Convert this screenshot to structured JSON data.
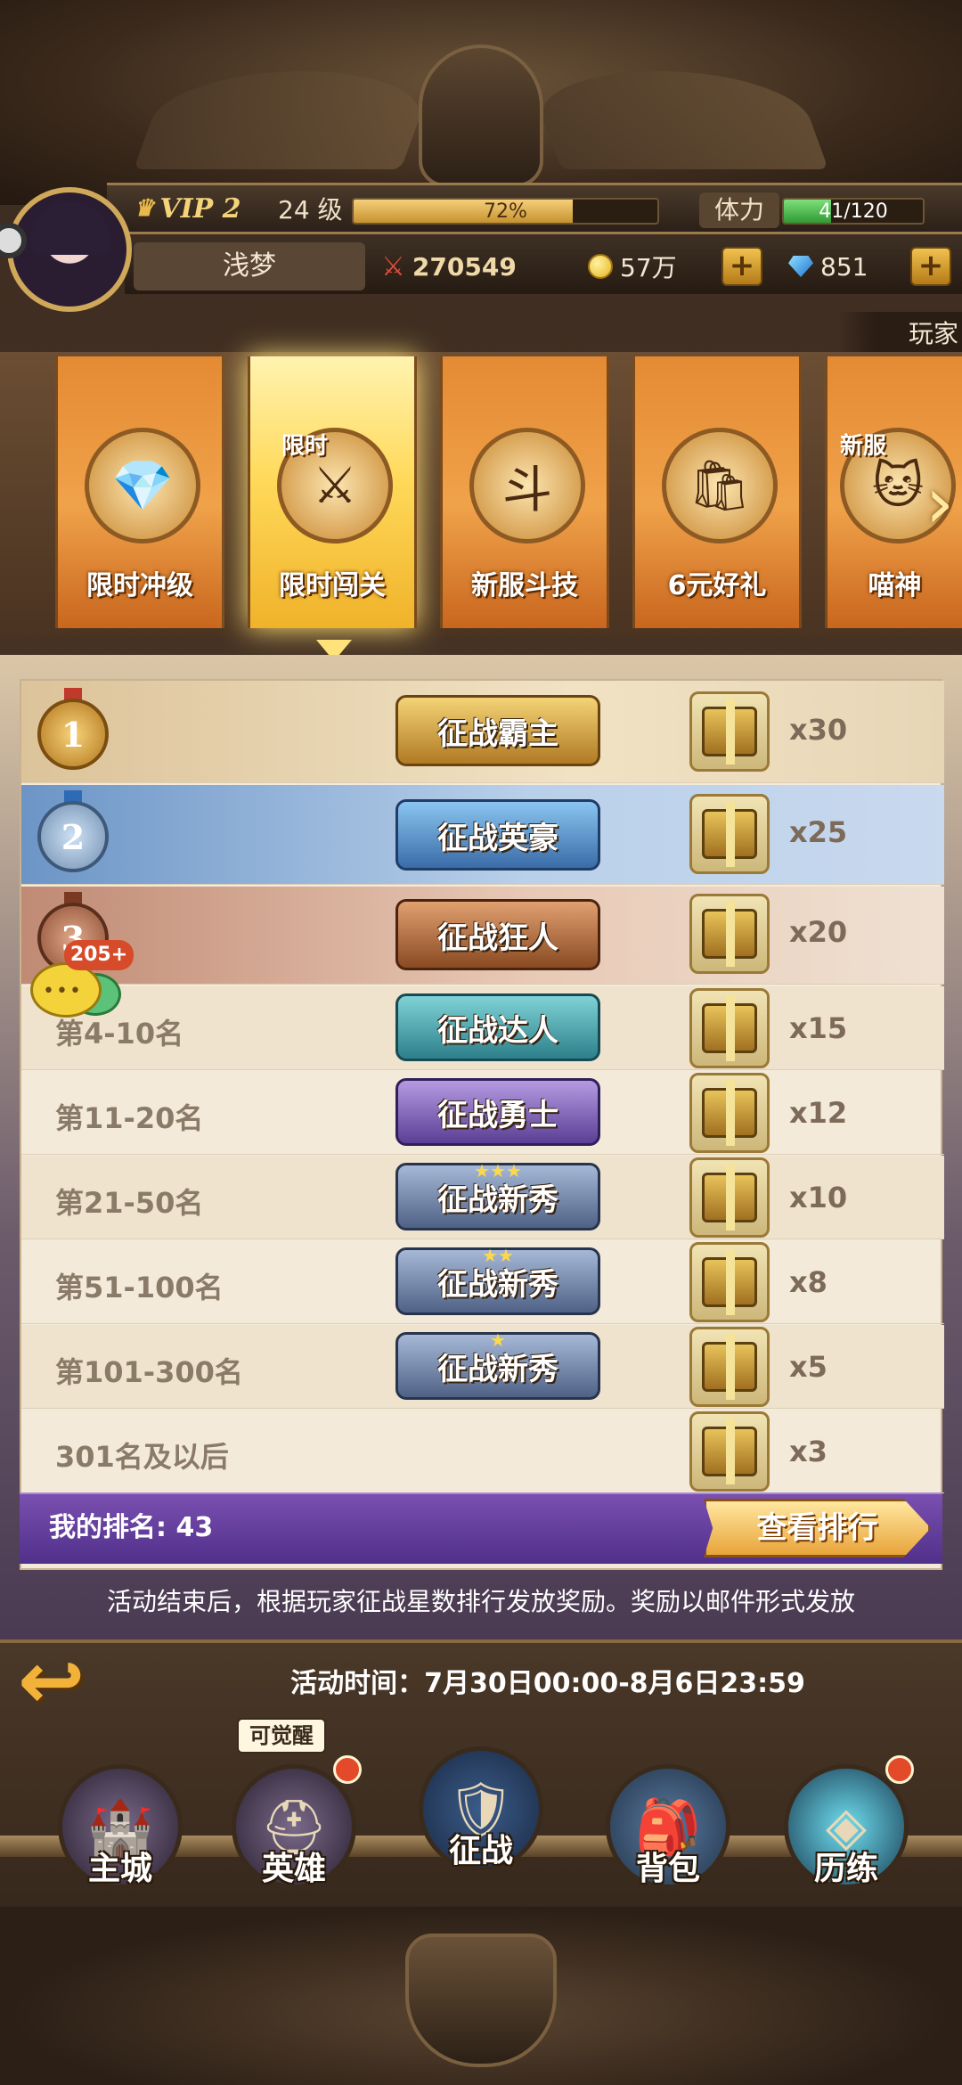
{
  "header": {
    "vip_label": "VIP 2",
    "level": "24 级",
    "exp_percent_text": "72%",
    "exp_fraction": 0.72,
    "stamina_label": "体力",
    "stamina_text": "41/120",
    "stamina_fraction": 0.34,
    "player_name": "浅梦",
    "power": "270549",
    "gold": "57万",
    "gems": "851",
    "player_tab": "玩家"
  },
  "activities": [
    {
      "label": "限时冲级",
      "icon": "treasure-chest-icon",
      "tag": ""
    },
    {
      "label": "限时闯关",
      "icon": "crossed-swords-icon",
      "tag": "限时"
    },
    {
      "label": "新服斗技",
      "icon": "winged-badge-icon",
      "tag": ""
    },
    {
      "label": "6元好礼",
      "icon": "gift-bag-icon",
      "tag": ""
    },
    {
      "label": "喵神",
      "icon": "cat-icon",
      "tag": "新服"
    }
  ],
  "rewards": [
    {
      "rank": "1",
      "title": "征战霸主",
      "qty": "x30"
    },
    {
      "rank": "2",
      "title": "征战英豪",
      "qty": "x25"
    },
    {
      "rank": "3",
      "title": "征战狂人",
      "qty": "x20"
    },
    {
      "rank": "第4-10名",
      "title": "征战达人",
      "qty": "x15"
    },
    {
      "rank": "第11-20名",
      "title": "征战勇士",
      "qty": "x12"
    },
    {
      "rank": "第21-50名",
      "title": "征战新秀",
      "qty": "x10",
      "stars": "★★★"
    },
    {
      "rank": "第51-100名",
      "title": "征战新秀",
      "qty": "x8",
      "stars": "★★"
    },
    {
      "rank": "第101-300名",
      "title": "征战新秀",
      "qty": "x5",
      "stars": "★"
    },
    {
      "rank": "301名及以后",
      "title": "",
      "qty": "x3"
    }
  ],
  "chat_badge": "205+",
  "my_rank": "我的排名: 43",
  "view_rank_button": "查看排行",
  "note": "活动结束后，根据玩家征战星数排行发放奖励。奖励以邮件形式发放",
  "activity_time": "活动时间：7月30日00:00-8月6日23:59",
  "awaken_tag": "可觉醒",
  "nav": [
    {
      "label": "主城",
      "icon": "castle-icon"
    },
    {
      "label": "英雄",
      "icon": "helmet-icon"
    },
    {
      "label": "征战",
      "icon": "shield-icon"
    },
    {
      "label": "背包",
      "icon": "backpack-icon"
    },
    {
      "label": "历练",
      "icon": "portal-icon"
    }
  ],
  "colors": {
    "accent_gold": "#f0b22a",
    "purple_bar": "#5d3a9a",
    "panel_bg": "#f4ead9"
  }
}
